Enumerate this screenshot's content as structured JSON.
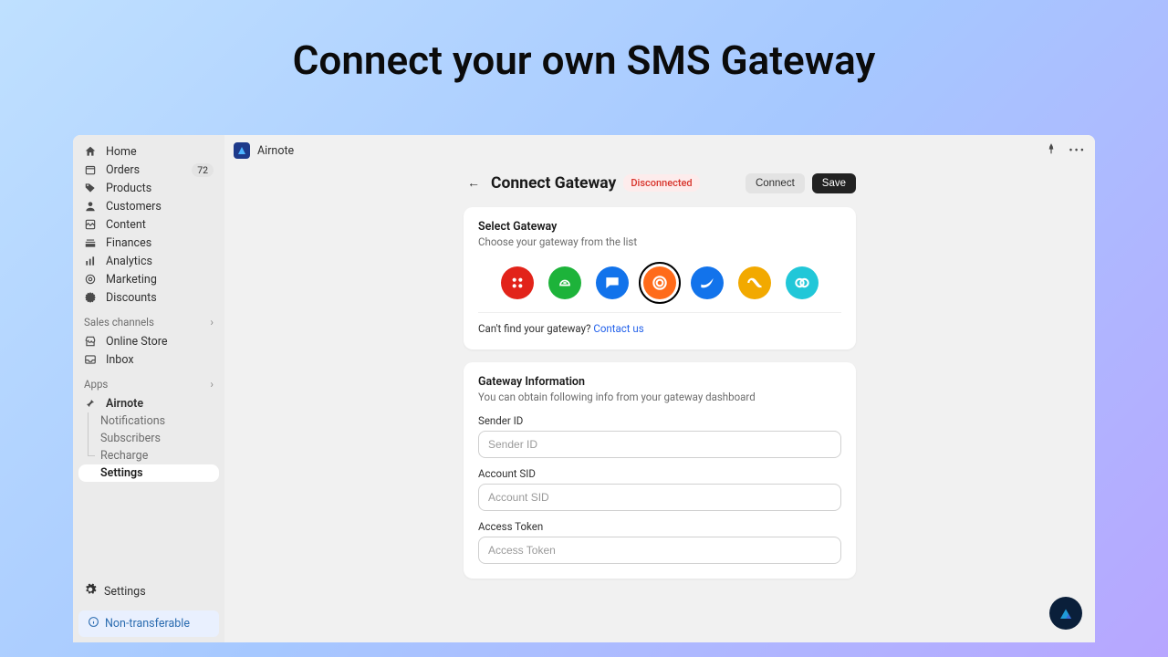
{
  "hero": {
    "title": "Connect your own SMS Gateway"
  },
  "topbar": {
    "app_name": "Airnote"
  },
  "sidebar": {
    "items": [
      {
        "label": "Home",
        "icon": "home"
      },
      {
        "label": "Orders",
        "icon": "orders",
        "badge": "72"
      },
      {
        "label": "Products",
        "icon": "tag"
      },
      {
        "label": "Customers",
        "icon": "user"
      },
      {
        "label": "Content",
        "icon": "content"
      },
      {
        "label": "Finances",
        "icon": "finance"
      },
      {
        "label": "Analytics",
        "icon": "analytics"
      },
      {
        "label": "Marketing",
        "icon": "target"
      },
      {
        "label": "Discounts",
        "icon": "discount"
      }
    ],
    "sales_label": "Sales channels",
    "sales": [
      {
        "label": "Online Store",
        "icon": "store"
      },
      {
        "label": "Inbox",
        "icon": "inbox"
      }
    ],
    "apps_label": "Apps",
    "app_active": "Airnote",
    "app_sub": [
      {
        "label": "Notifications"
      },
      {
        "label": "Subscribers"
      },
      {
        "label": "Recharge"
      },
      {
        "label": "Settings",
        "active": true
      }
    ],
    "footer_settings": "Settings",
    "nontransferable": "Non-transferable"
  },
  "page": {
    "title": "Connect Gateway",
    "status": "Disconnected",
    "connect_btn": "Connect",
    "save_btn": "Save"
  },
  "select_card": {
    "title": "Select Gateway",
    "subtitle": "Choose your gateway from the list",
    "help_prefix": "Can't find your gateway? ",
    "help_link": "Contact us",
    "gateways": [
      {
        "name": "twilio",
        "color": "#e2231a"
      },
      {
        "name": "green-gw",
        "color": "#1db33a"
      },
      {
        "name": "blue-chat",
        "color": "#1273eb"
      },
      {
        "name": "orange-target",
        "color": "#ff6b1a",
        "selected": true
      },
      {
        "name": "messagebird",
        "color": "#1273eb"
      },
      {
        "name": "loop-gw",
        "color": "#f2a900"
      },
      {
        "name": "cyan-link",
        "color": "#21c7d8"
      }
    ]
  },
  "info_card": {
    "title": "Gateway Information",
    "subtitle": "You can obtain following info from your gateway dashboard",
    "fields": [
      {
        "label": "Sender ID",
        "placeholder": "Sender ID"
      },
      {
        "label": "Account SID",
        "placeholder": "Account SID"
      },
      {
        "label": "Access Token",
        "placeholder": "Access Token"
      }
    ]
  }
}
